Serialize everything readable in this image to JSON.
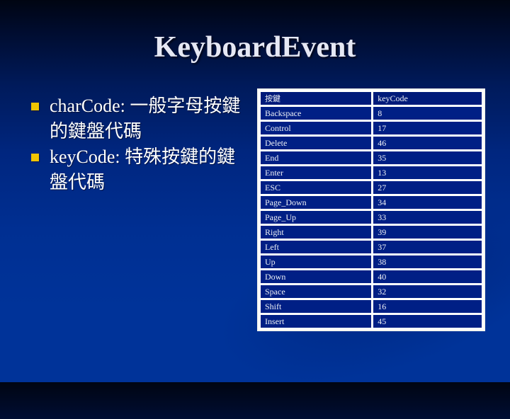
{
  "slide": {
    "title": "KeyboardEvent",
    "bullets": [
      {
        "term": "charCode: ",
        "description": "一般字母按鍵的鍵盤代碼"
      },
      {
        "term": "keyCode: ",
        "description": "特殊按鍵的鍵盤代碼"
      }
    ],
    "bullet_marker_color": "#f2c500",
    "table": {
      "headers": [
        "按鍵",
        "keyCode"
      ],
      "rows": [
        {
          "key": "Backspace",
          "code": "8"
        },
        {
          "key": "Control",
          "code": "17"
        },
        {
          "key": "Delete",
          "code": "46"
        },
        {
          "key": "End",
          "code": "35"
        },
        {
          "key": "Enter",
          "code": "13"
        },
        {
          "key": "ESC",
          "code": "27"
        },
        {
          "key": "Page_Down",
          "code": "34"
        },
        {
          "key": "Page_Up",
          "code": "33"
        },
        {
          "key": "Right",
          "code": "39"
        },
        {
          "key": "Left",
          "code": "37"
        },
        {
          "key": "Up",
          "code": "38"
        },
        {
          "key": "Down",
          "code": "40"
        },
        {
          "key": "Space",
          "code": "32"
        },
        {
          "key": "Shift",
          "code": "16"
        },
        {
          "key": "Insert",
          "code": "45"
        }
      ]
    }
  }
}
